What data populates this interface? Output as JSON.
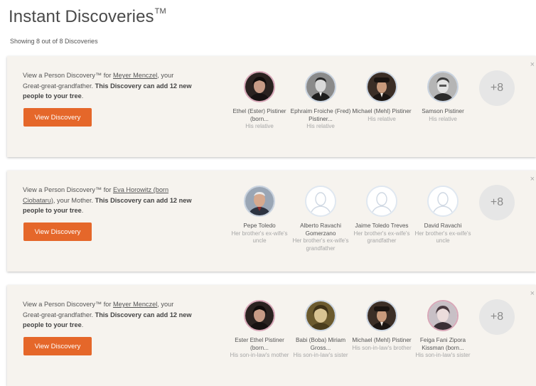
{
  "page": {
    "title": "Instant Discoveries",
    "tm": "TM",
    "showing": "Showing 8 out of 8 Discoveries"
  },
  "colors": {
    "button": "#e5672a",
    "card_bg": "#f6f3ee"
  },
  "cards": [
    {
      "close": "×",
      "prefix": "View a Person Discovery™ for ",
      "link": "Meyer Menczel",
      "relation": ", your Great-great-grandfather. ",
      "bold": "This Discovery can add 12 new people to your tree",
      "suffix": ".",
      "button": "View Discovery",
      "more": "+8",
      "people": [
        {
          "name": "Ethel (Ester) Pistiner (born...",
          "relation": "His relative",
          "avatar": "photo-dark-woman-icon"
        },
        {
          "name": "Ephraim Froiche (Fred) Pistiner...",
          "relation": "His relative",
          "avatar": "photo-bw-man-icon"
        },
        {
          "name": "Michael (Mehl) Pistiner",
          "relation": "His relative",
          "avatar": "photo-man-hat-icon"
        },
        {
          "name": "Samson Pistiner",
          "relation": "His relative",
          "avatar": "photo-bw-man-icon"
        }
      ]
    },
    {
      "close": "×",
      "prefix": "View a Person Discovery™ for ",
      "link": "Eva Horowitz (born Ciobataru)",
      "relation": ", your Mother. ",
      "bold": "This Discovery can add 12 new people to your tree",
      "suffix": ".",
      "button": "View Discovery",
      "more": "+8",
      "people": [
        {
          "name": "Pepe Toledo",
          "relation": "Her brother's ex-wife's uncle",
          "avatar": "photo-old-man-icon"
        },
        {
          "name": "Alberto Ravachi Gomerzano",
          "relation": "Her brother's ex-wife's grandfather",
          "avatar": "silhouette-male-icon"
        },
        {
          "name": "Jaime Toledo Treves",
          "relation": "Her brother's ex-wife's grandfather",
          "avatar": "silhouette-male-icon"
        },
        {
          "name": "David Ravachi",
          "relation": "Her brother's ex-wife's uncle",
          "avatar": "silhouette-male-icon"
        }
      ]
    },
    {
      "close": "×",
      "prefix": "View a Person Discovery™ for ",
      "link": "Meyer Menczel",
      "relation": ", your Great-great-grandfather. ",
      "bold": "This Discovery can add 12 new people to your tree",
      "suffix": ".",
      "button": "View Discovery",
      "more": "+8",
      "people": [
        {
          "name": "Ester Ethel Pistiner (born...",
          "relation": "His son-in-law's mother",
          "avatar": "photo-dark-woman-icon"
        },
        {
          "name": "Babi (Boba) Miriam Gross...",
          "relation": "His son-in-law's sister",
          "avatar": "photo-sepia-woman-icon"
        },
        {
          "name": "Michael (Mehl) Pistiner",
          "relation": "His son-in-law's brother",
          "avatar": "photo-man-hat-icon"
        },
        {
          "name": "Feiga Fani Zipora Kissman (born...",
          "relation": "His son-in-law's sister",
          "avatar": "photo-woman-icon"
        }
      ]
    }
  ]
}
